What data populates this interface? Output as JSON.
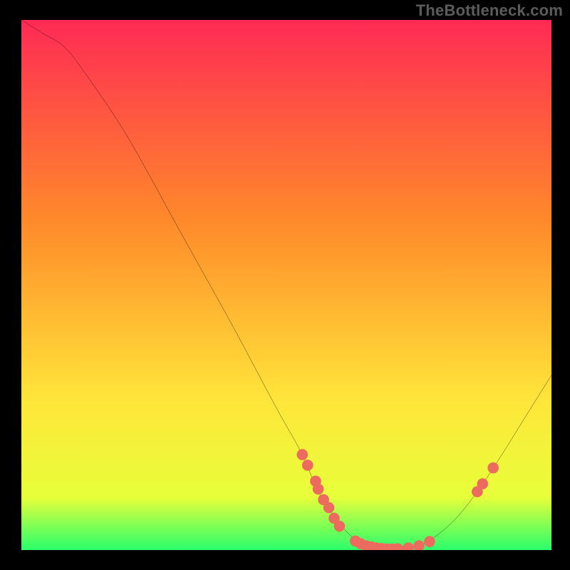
{
  "watermark": "TheBottleneck.com",
  "chart_data": {
    "type": "line",
    "title": "",
    "xlabel": "",
    "ylabel": "",
    "xlim": [
      0,
      100
    ],
    "ylim": [
      0,
      100
    ],
    "background_gradient": {
      "top": "#ff2a55",
      "mid1": "#ff8a2a",
      "mid2": "#ffe63a",
      "band": "#e7ff3a",
      "bottom": "#2aff6b"
    },
    "marker_color": "#ed6a5e",
    "curve_stroke": "#000000",
    "curve": [
      {
        "x": 0,
        "y": 100
      },
      {
        "x": 4,
        "y": 97.5
      },
      {
        "x": 8,
        "y": 95
      },
      {
        "x": 12,
        "y": 90
      },
      {
        "x": 20,
        "y": 78
      },
      {
        "x": 30,
        "y": 60
      },
      {
        "x": 40,
        "y": 42
      },
      {
        "x": 48,
        "y": 27
      },
      {
        "x": 53,
        "y": 18
      },
      {
        "x": 56,
        "y": 11
      },
      {
        "x": 60,
        "y": 5
      },
      {
        "x": 63,
        "y": 2
      },
      {
        "x": 66,
        "y": 0.5
      },
      {
        "x": 70,
        "y": 0
      },
      {
        "x": 74,
        "y": 0.5
      },
      {
        "x": 78,
        "y": 2.5
      },
      {
        "x": 82,
        "y": 6
      },
      {
        "x": 86,
        "y": 11
      },
      {
        "x": 90,
        "y": 17
      },
      {
        "x": 95,
        "y": 25
      },
      {
        "x": 100,
        "y": 33
      }
    ],
    "markers": [
      {
        "x": 53,
        "y": 18
      },
      {
        "x": 54,
        "y": 16
      },
      {
        "x": 55.5,
        "y": 13
      },
      {
        "x": 56,
        "y": 11.5
      },
      {
        "x": 57,
        "y": 9.5
      },
      {
        "x": 58,
        "y": 8
      },
      {
        "x": 59,
        "y": 6
      },
      {
        "x": 60,
        "y": 4.5
      },
      {
        "x": 63,
        "y": 1.7
      },
      {
        "x": 64,
        "y": 1.2
      },
      {
        "x": 65,
        "y": 0.8
      },
      {
        "x": 66,
        "y": 0.6
      },
      {
        "x": 67,
        "y": 0.4
      },
      {
        "x": 68,
        "y": 0.3
      },
      {
        "x": 69,
        "y": 0.2
      },
      {
        "x": 70,
        "y": 0.2
      },
      {
        "x": 71,
        "y": 0.25
      },
      {
        "x": 73,
        "y": 0.4
      },
      {
        "x": 75,
        "y": 0.8
      },
      {
        "x": 77,
        "y": 1.6
      },
      {
        "x": 86,
        "y": 11
      },
      {
        "x": 87,
        "y": 12.5
      },
      {
        "x": 89,
        "y": 15.5
      }
    ]
  }
}
